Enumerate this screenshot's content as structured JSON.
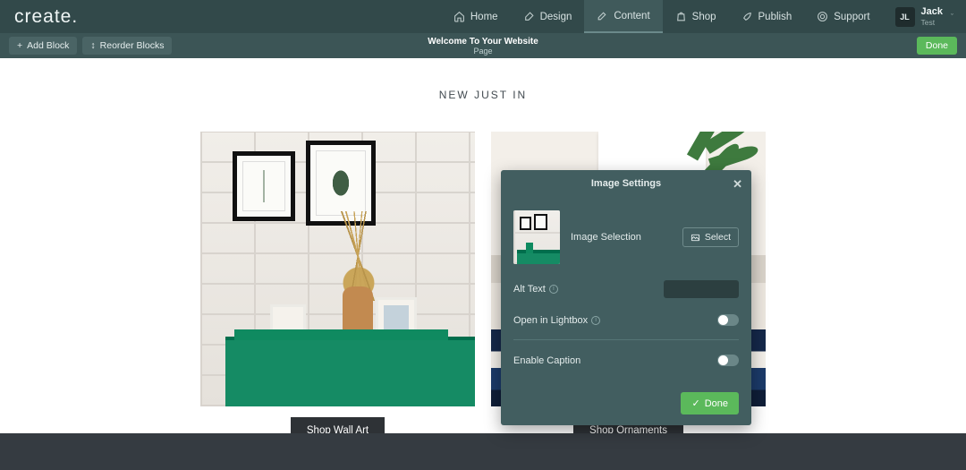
{
  "logo": "create",
  "nav": [
    {
      "label": "Home",
      "icon": "home-icon"
    },
    {
      "label": "Design",
      "icon": "brush-icon"
    },
    {
      "label": "Content",
      "icon": "pencil-icon",
      "active": true
    },
    {
      "label": "Shop",
      "icon": "bag-icon"
    },
    {
      "label": "Publish",
      "icon": "rocket-icon"
    },
    {
      "label": "Support",
      "icon": "life-ring-icon"
    }
  ],
  "user": {
    "initials": "JL",
    "name": "Jack",
    "sub": "Test"
  },
  "toolbar": {
    "add_block": "Add Block",
    "reorder_blocks": "Reorder Blocks",
    "title": "Welcome To Your Website",
    "subtitle": "Page",
    "done": "Done"
  },
  "section": {
    "heading": "NEW JUST IN"
  },
  "cards": [
    {
      "cta": "Shop Wall Art"
    },
    {
      "cta": "Shop Ornaments"
    }
  ],
  "panel": {
    "title": "Image Settings",
    "image_selection_label": "Image Selection",
    "select_btn": "Select",
    "alt_text_label": "Alt Text",
    "alt_text_value": "",
    "lightbox_label": "Open in Lightbox",
    "lightbox_on": false,
    "caption_label": "Enable Caption",
    "caption_on": false,
    "done": "Done"
  }
}
